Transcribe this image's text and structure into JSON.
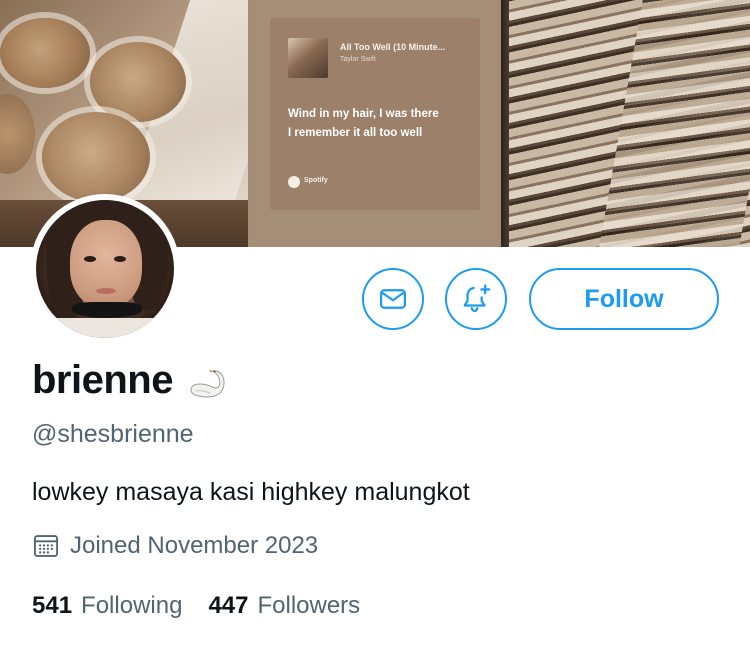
{
  "banner": {
    "music_card": {
      "track_title": "All Too Well (10 Minute...",
      "artist": "Taylor Swift",
      "lyric_line_1": "Wind in my hair, I was there",
      "lyric_line_2": "I remember it all too well",
      "source_label": "Spotify"
    }
  },
  "actions": {
    "message_icon": "envelope-icon",
    "notify_icon": "bell-plus-icon",
    "follow_label": "Follow"
  },
  "profile": {
    "display_name": "brienne",
    "name_emoji": "swan-emoji",
    "handle": "@shesbrienne",
    "bio": "lowkey masaya kasi highkey malungkot",
    "joined_icon": "calendar-icon",
    "joined": "Joined November 2023"
  },
  "stats": {
    "following_count": "541",
    "following_label": "Following",
    "followers_count": "447",
    "followers_label": "Followers"
  },
  "colors": {
    "accent": "#1d9bf0",
    "text_primary": "#0f1419",
    "text_secondary": "#536471"
  }
}
